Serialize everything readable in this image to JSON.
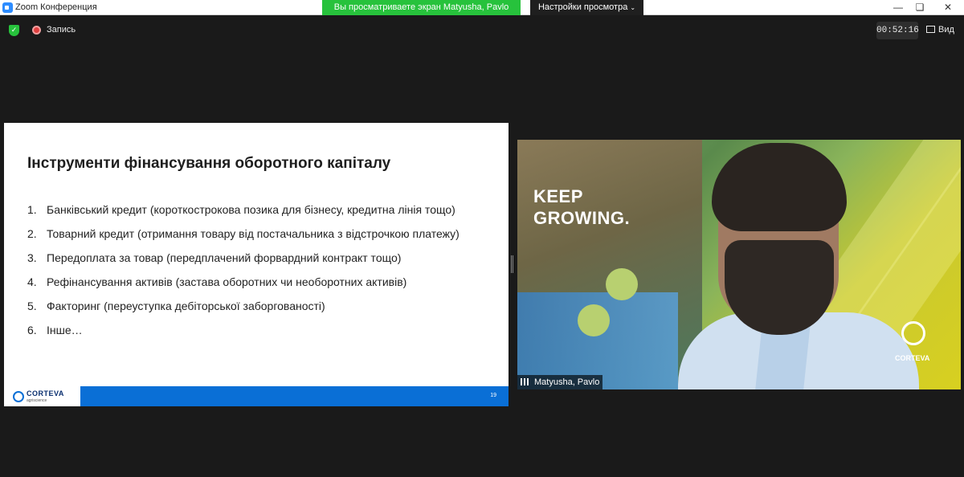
{
  "titlebar": {
    "app_title": "Zoom Конференция",
    "share_banner": "Вы просматриваете экран Matyusha, Pavlo",
    "view_options": "Настройки просмотра"
  },
  "toolbar": {
    "record_label": "Запись",
    "timer": "00:52:16",
    "view_label": "Вид"
  },
  "slide": {
    "title": "Інструменти фінансування оборотного капіталу",
    "items": [
      {
        "num": "1.",
        "text": "Банківський кредит (короткострокова позика для бізнесу, кредитна лінія тощо)"
      },
      {
        "num": "2.",
        "text": "Товарний кредит (отримання товару від постачальника з відстрочкою платежу)"
      },
      {
        "num": "3.",
        "text": "Передоплата за товар (передплачений форвардний контракт тощо)"
      },
      {
        "num": "4.",
        "text": "Рефінансування активів (застава оборотних чи необоротних активів)"
      },
      {
        "num": "5.",
        "text": "Факторинг (переуступка дебіторської заборгованості)"
      },
      {
        "num": "6.",
        "text": "Інше…"
      }
    ],
    "footer_brand": "CORTEVA",
    "footer_sub": "agriscience",
    "page_number": "19"
  },
  "video": {
    "banner_line1": "KEEP",
    "banner_line2": "GROWING.",
    "corteva_text": "CORTEVA",
    "participant_name": "Matyusha, Pavlo"
  },
  "colors": {
    "share_green": "#27c23c",
    "slide_blue": "#0a6fd6",
    "record_red": "#e04040"
  },
  "icons": [
    "zoom-app-icon",
    "shield-icon",
    "record-icon",
    "chevron-down-icon",
    "minimize-icon",
    "maximize-icon",
    "close-icon",
    "grid-view-icon",
    "signal-bars-icon",
    "corteva-logo-icon"
  ]
}
